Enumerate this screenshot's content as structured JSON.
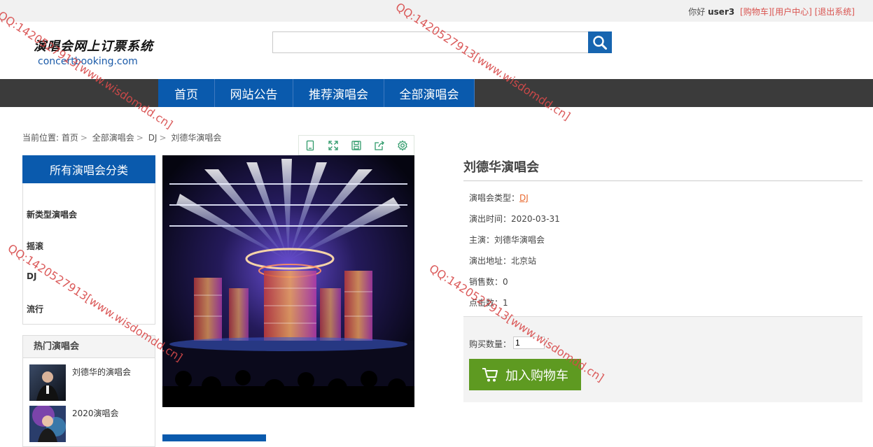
{
  "topbar": {
    "greeting": "你好",
    "username": "user3",
    "links": [
      "[购物车]",
      "[用户中心]",
      "[退出系统]"
    ]
  },
  "logo": {
    "title_cn": "演唱会网上订票系统",
    "domain": "concertbooking.com"
  },
  "search": {
    "placeholder": "",
    "value": ""
  },
  "nav": {
    "items": [
      "首页",
      "网站公告",
      "推荐演唱会",
      "全部演唱会"
    ]
  },
  "breadcrumb": {
    "prefix": "当前位置:",
    "items": [
      "首页",
      "全部演唱会",
      "DJ",
      "刘德华演唱会"
    ]
  },
  "sidebar": {
    "categories_title": "所有演唱会分类",
    "categories": [
      "新类型演唱会",
      "摇滚",
      "DJ",
      "流行"
    ],
    "hot_title": "热门演唱会",
    "hot_items": [
      {
        "title": "刘德华的演唱会"
      },
      {
        "title": "2020演唱会"
      }
    ]
  },
  "toolbar": {
    "icons": [
      "copy-icon",
      "fullscreen-icon",
      "save-icon",
      "share-icon",
      "settings-icon"
    ]
  },
  "concert": {
    "title": "刘德华演唱会",
    "type_label": "演唱会类型：",
    "type_value": "DJ",
    "time": "演出时间：2020-03-31",
    "star": "主演：刘德华演唱会",
    "address": "演出地址：北京站",
    "sales": "销售数：0",
    "clicks": "点击数：1"
  },
  "buy": {
    "qty_label": "购买数量：",
    "qty_value": "1",
    "cart_button": "加入购物车"
  },
  "watermark": "QQ:1420527913[www.wisdomdd.cn]",
  "colors": {
    "nav_blue": "#0a5aad",
    "nav_bar": "#3b3b3b",
    "cart_green": "#5e9a21",
    "link_red": "#d9534f"
  }
}
